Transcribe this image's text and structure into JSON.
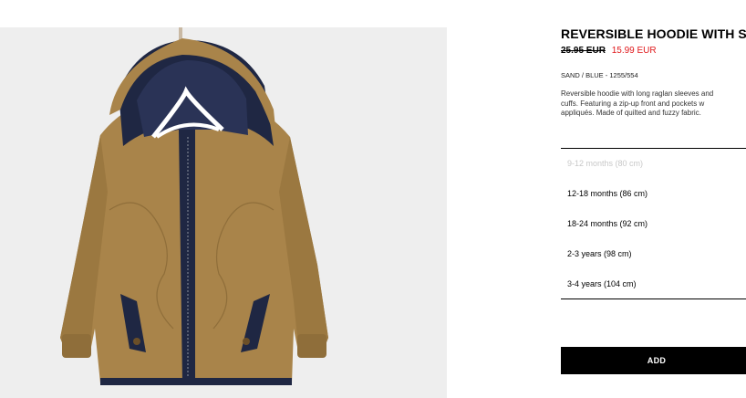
{
  "product": {
    "title": "REVERSIBLE HOODIE WITH STAR",
    "old_price": "25.95 EUR",
    "new_price": "15.99 EUR",
    "color_ref": "SAND / BLUE - 1255/554",
    "description": "Reversible hoodie with long raglan sleeves and\ncuffs. Featuring a zip-up front and pockets w\nappliqués. Made of quilted and fuzzy fabric.",
    "image": {
      "subject": "jacket-on-hanger",
      "outer_color": "#a9844a",
      "lining_color": "#1f2743",
      "background_color": "#eeeeee"
    }
  },
  "sizes": [
    {
      "label": "9-12 months (80 cm)",
      "available": false
    },
    {
      "label": "12-18 months (86 cm)",
      "available": true
    },
    {
      "label": "18-24 months (92 cm)",
      "available": true
    },
    {
      "label": "2-3 years (98 cm)",
      "available": true
    },
    {
      "label": "3-4 years (104 cm)",
      "available": true
    }
  ],
  "actions": {
    "add_label": "ADD"
  },
  "colors": {
    "sale_price": "#e0181b",
    "button_bg": "#000000",
    "button_text": "#ffffff",
    "unavailable_text": "#c8c8c8"
  }
}
